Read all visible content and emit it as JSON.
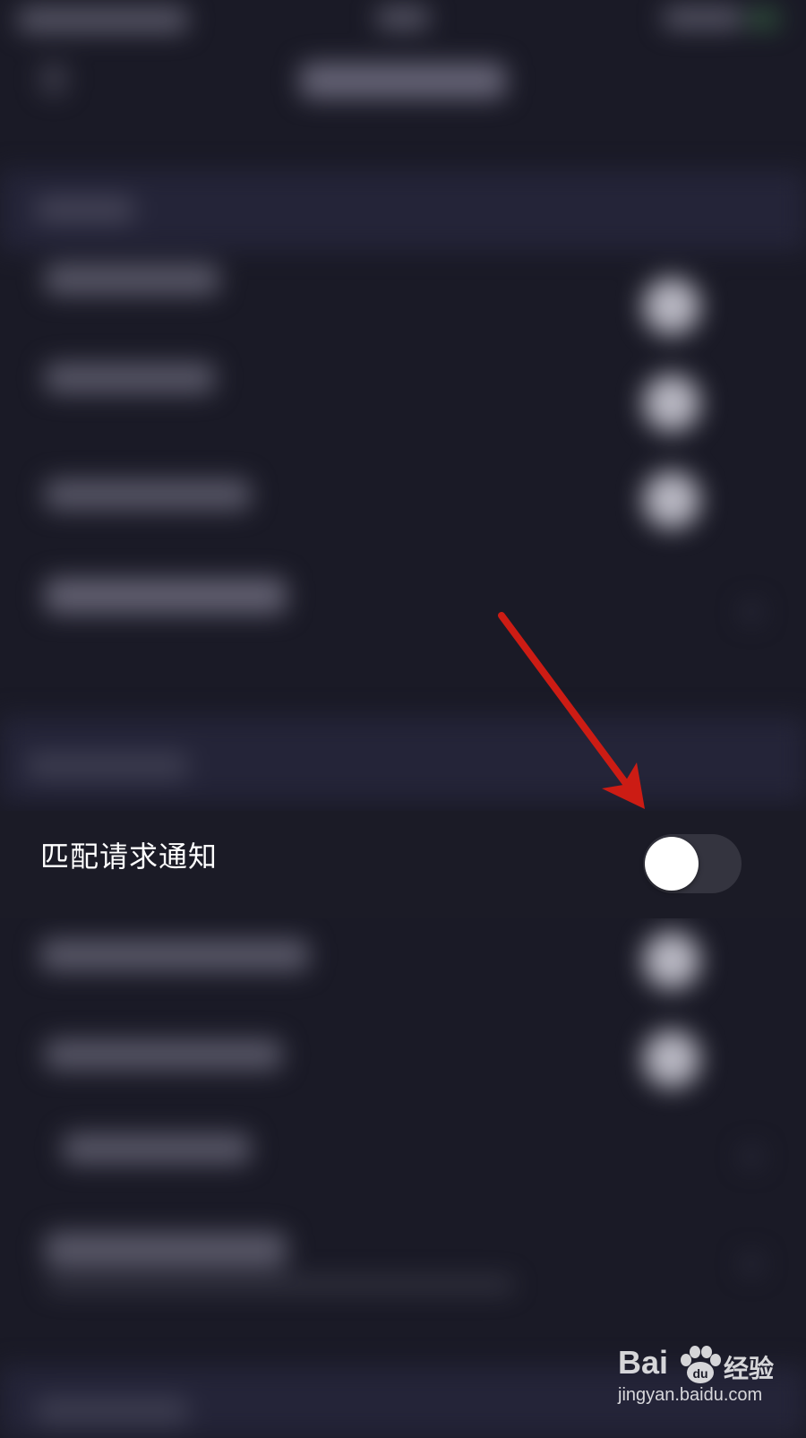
{
  "settings": {
    "focused_item": {
      "label": "匹配请求通知",
      "toggle_on": false
    }
  },
  "annotation": {
    "arrow_color": "#cc1c14"
  },
  "watermark": {
    "logo": "Bai",
    "label": "经验",
    "url": "jingyan.baidu.com"
  }
}
